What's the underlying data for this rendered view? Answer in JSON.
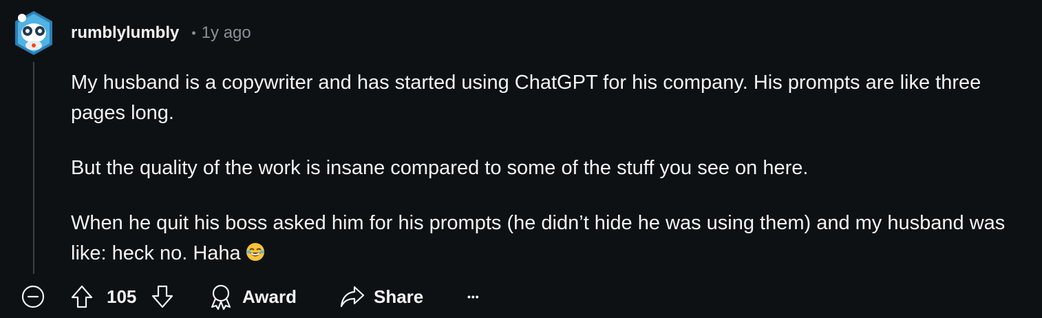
{
  "comment": {
    "username": "rumblylumbly",
    "separator": "•",
    "time": "1y ago",
    "paragraphs": [
      "My husband is a copywriter and has started using ChatGPT for his company. His prompts are like three pages long.",
      "But the quality of the work is insane compared to some of the stuff you see on here.",
      "When he quit his boss asked him for his prompts (he didn’t hide he was using them) and my husband was like: heck no. Haha"
    ],
    "emoji": "face-with-tears-of-joy"
  },
  "actions": {
    "collapse_icon": "collapse-minus-icon",
    "score": "105",
    "award_label": "Award",
    "share_label": "Share",
    "more_label": "•••"
  },
  "colors": {
    "background": "#0e1113",
    "text": "#f2f3f5",
    "meta": "#8a9196",
    "thread_line": "#3e4244"
  }
}
